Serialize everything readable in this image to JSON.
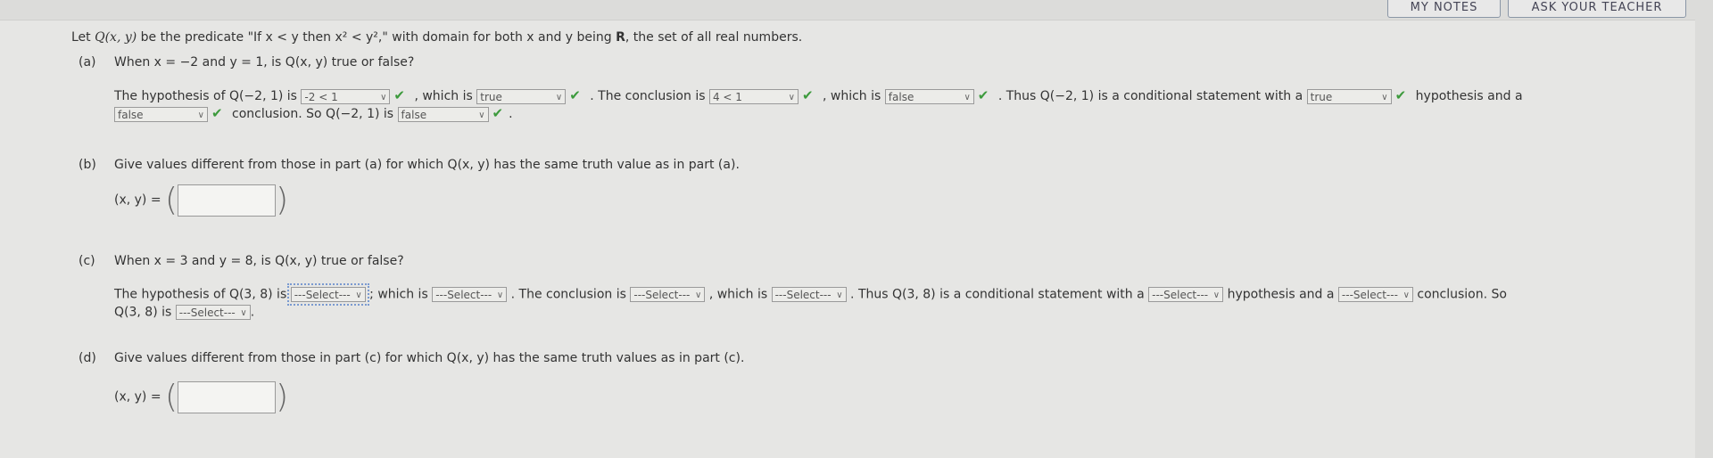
{
  "header": {
    "my_notes": "MY NOTES",
    "ask_teacher": "ASK YOUR TEACHER"
  },
  "intro": {
    "a": "Let ",
    "b": "Q(x, y)",
    "c": " be the predicate \"If x < y then x² < y²,\" with domain for both x and y being ",
    "d": "R",
    "e": ", the set of all real numbers."
  },
  "a": {
    "label": "(a)",
    "question": "When x = −2 and y = 1, is Q(x, y) true or false?",
    "t1": "The hypothesis of Q(−2, 1) is",
    "s1": "-2 < 1",
    "t2": ", which is",
    "s2": "true",
    "t3": ". The conclusion is",
    "s3": "4 < 1",
    "t4": ", which is",
    "s4": "false",
    "t5": ". Thus Q(−2, 1) is a conditional statement with a",
    "s5": "true",
    "t6": "hypothesis and a",
    "s6": "false",
    "t7": "conclusion. So Q(−2, 1) is",
    "s7": "false",
    "t8": "."
  },
  "b": {
    "label": "(b)",
    "question": "Give values different from those in part (a) for which Q(x, y) has the same truth value as in part (a).",
    "xy": "(x, y) =",
    "value": ""
  },
  "c": {
    "label": "(c)",
    "question": "When x = 3 and y = 8, is Q(x, y) true or false?",
    "t1": "The hypothesis of Q(3, 8) is",
    "s1": "---Select---",
    "t2": "; which is",
    "s2": "---Select---",
    "t3": ". The conclusion is",
    "s3": "---Select---",
    "t4": ", which is",
    "s4": "---Select---",
    "t5": ". Thus Q(3, 8) is a conditional statement with a",
    "s5": "---Select---",
    "t6": "hypothesis and a",
    "s6": "---Select---",
    "t7": "conclusion. So",
    "t8": "Q(3, 8) is",
    "s7": "---Select---",
    "t9": "."
  },
  "d": {
    "label": "(d)",
    "question": "Give values different from those in part (c) for which Q(x, y) has the same truth values as in part (c).",
    "xy": "(x, y) =",
    "value": ""
  },
  "icons": {
    "check": "check-icon",
    "chevron": "chevron-down-icon"
  },
  "colors": {
    "check": "#3c9a3c"
  }
}
